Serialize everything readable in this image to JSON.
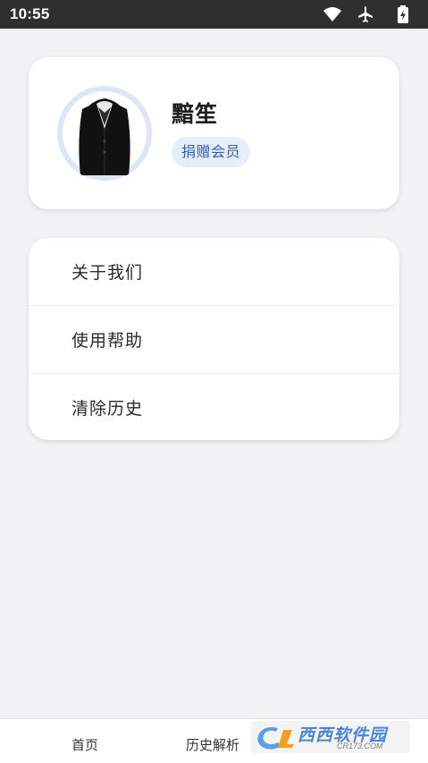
{
  "status_bar": {
    "time": "10:55",
    "icons": [
      "wifi-icon",
      "airplane-icon",
      "battery-charging-icon"
    ]
  },
  "profile": {
    "username": "黯笙",
    "badge_label": "捐赠会员",
    "accent_color": "#3460b3",
    "avatar": "avatar-black-jacket"
  },
  "menu": {
    "items": [
      {
        "label": "关于我们"
      },
      {
        "label": "使用帮助"
      },
      {
        "label": "清除历史"
      }
    ]
  },
  "bottom_nav": {
    "items": [
      {
        "label": "首页"
      },
      {
        "label": "历史解析"
      }
    ]
  },
  "watermark": {
    "main": "西西软件园",
    "domain": "CR173.COM"
  }
}
